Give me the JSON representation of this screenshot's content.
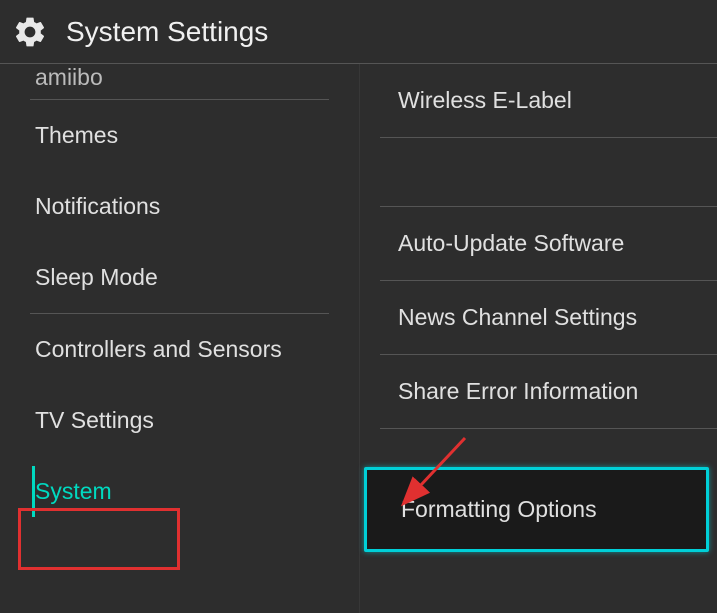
{
  "header": {
    "title": "System Settings"
  },
  "sidebar": {
    "cutoff_item": "amiibo",
    "items": [
      {
        "label": "Themes"
      },
      {
        "label": "Notifications"
      },
      {
        "label": "Sleep Mode"
      },
      {
        "label": "Controllers and Sensors"
      },
      {
        "label": "TV Settings"
      },
      {
        "label": "System",
        "selected": true
      }
    ]
  },
  "main": {
    "items": [
      {
        "label": "Wireless E-Label"
      },
      {
        "label": "Auto-Update Software"
      },
      {
        "label": "News Channel Settings"
      },
      {
        "label": "Share Error Information"
      },
      {
        "label": "Formatting Options",
        "highlighted": true
      }
    ]
  },
  "annotations": {
    "red_box": {
      "target": "System"
    },
    "arrow": {
      "target": "Formatting Options"
    }
  }
}
